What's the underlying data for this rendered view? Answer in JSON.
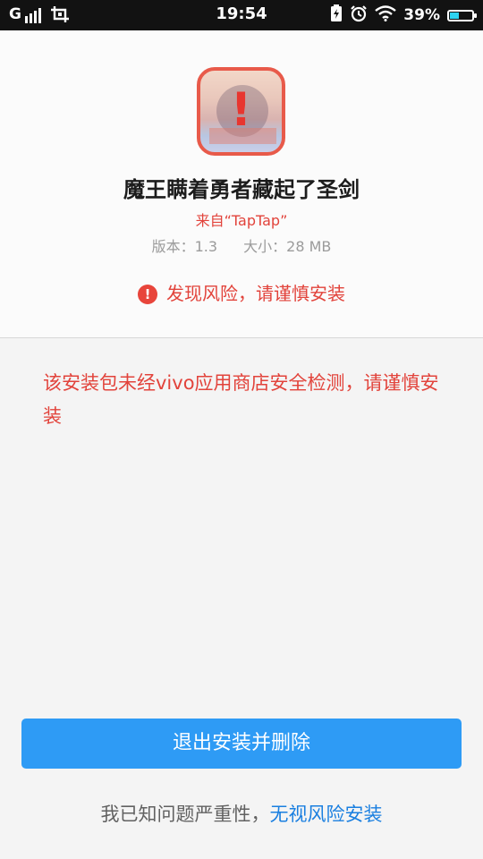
{
  "status_bar": {
    "signal_label": "G",
    "time": "19:54",
    "battery_percent_text": "39%",
    "battery_level": 0.39,
    "icons": [
      "signal-icon",
      "screenshot-crop-icon",
      "battery-saver-icon",
      "alarm-icon",
      "wifi-icon",
      "battery-icon"
    ]
  },
  "app": {
    "name": "魔王瞒着勇者藏起了圣剑",
    "source": "来自“TapTap”",
    "version": "版本：1.3",
    "size": "大小：28 MB",
    "icon_warning_glyph": "!"
  },
  "risk": {
    "icon": "!",
    "text": "发现风险，请谨慎安装"
  },
  "warning_message": "该安装包未经vivo应用商店安全检测，请谨慎安装",
  "actions": {
    "exit_button": "退出安装并删除",
    "ignore_prefix": "我已知问题严重性，",
    "ignore_link": "无视风险安装"
  },
  "colors": {
    "accent_blue": "#2e9bf5",
    "link_blue": "#1a7fe0",
    "danger_red": "#e2433b",
    "status_bar_bg": "#121212"
  }
}
